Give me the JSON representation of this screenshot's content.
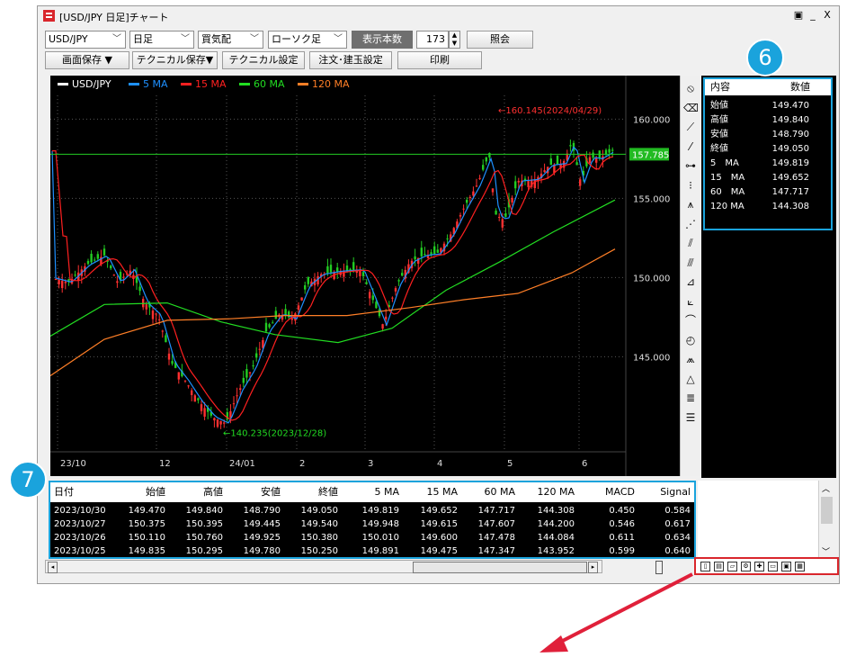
{
  "window": {
    "title": "[USD/JPY 日足]チャート",
    "controls": [
      "▣",
      "_",
      "X"
    ]
  },
  "toolbar": {
    "symbol": "USD/JPY",
    "period": "日足",
    "side": "買気配",
    "chart_type": "ローソク足",
    "count_label": "表示本数",
    "count_value": "173",
    "query_button": "照会",
    "save_screen": "画面保存 ▼",
    "save_technical": "テクニカル保存▼",
    "technical_settings": "テクニカル設定",
    "order": "注文･建玉設定",
    "print": "印刷"
  },
  "chart": {
    "legend": [
      {
        "label": "USD/JPY",
        "color": "#ffffff"
      },
      {
        "label": "5 MA",
        "color": "#1e90ff"
      },
      {
        "label": "15 MA",
        "color": "#ff2020"
      },
      {
        "label": "60 MA",
        "color": "#22dd22"
      },
      {
        "label": "120 MA",
        "color": "#ff7f27"
      }
    ],
    "y_ticks": [
      "160.000",
      "155.000",
      "150.000",
      "145.000"
    ],
    "x_ticks": [
      "23/10",
      "12",
      "24/01",
      "2",
      "3",
      "4",
      "5",
      "6"
    ],
    "high_annotation": "←160.145(2024/04/29)",
    "low_annotation": "←140.235(2023/12/28)",
    "current_price": "157.785"
  },
  "data_window": {
    "badge": "6",
    "headers": [
      "内容",
      "数値"
    ],
    "rows": [
      [
        "始値",
        "149.470"
      ],
      [
        "高値",
        "149.840"
      ],
      [
        "安値",
        "148.790"
      ],
      [
        "終値",
        "149.050"
      ],
      [
        "5　MA",
        "149.819"
      ],
      [
        "15　MA",
        "149.652"
      ],
      [
        "60　MA",
        "147.717"
      ],
      [
        "120 MA",
        "144.308"
      ]
    ]
  },
  "table": {
    "badge": "7",
    "headers": [
      "日付",
      "始値",
      "高値",
      "安値",
      "終値",
      "5 MA",
      "15 MA",
      "60 MA",
      "120 MA",
      "MACD",
      "Signal"
    ],
    "rows": [
      [
        "2023/10/30",
        "149.470",
        "149.840",
        "148.790",
        "149.050",
        "149.819",
        "149.652",
        "147.717",
        "144.308",
        "0.450",
        "0.584"
      ],
      [
        "2023/10/27",
        "150.375",
        "150.395",
        "149.445",
        "149.540",
        "149.948",
        "149.615",
        "147.607",
        "144.200",
        "0.546",
        "0.617"
      ],
      [
        "2023/10/26",
        "150.110",
        "150.760",
        "149.925",
        "150.380",
        "150.010",
        "149.600",
        "147.478",
        "144.084",
        "0.611",
        "0.634"
      ],
      [
        "2023/10/25",
        "149.835",
        "150.295",
        "149.780",
        "150.250",
        "149.891",
        "149.475",
        "147.347",
        "143.952",
        "0.599",
        "0.640"
      ]
    ]
  },
  "tools": [
    "no-entry-icon",
    "eraser-icon",
    "trendline-icon",
    "line-icon",
    "horizontal-line-icon",
    "vertical-line-icon",
    "fibonacci-icon",
    "gann-icon",
    "channel-icon",
    "parallel-icon",
    "regression-icon",
    "fan-icon",
    "arc-icon",
    "cycle-icon",
    "wedge-icon",
    "triangle-icon",
    "levels-icon",
    "bars-icon"
  ]
}
